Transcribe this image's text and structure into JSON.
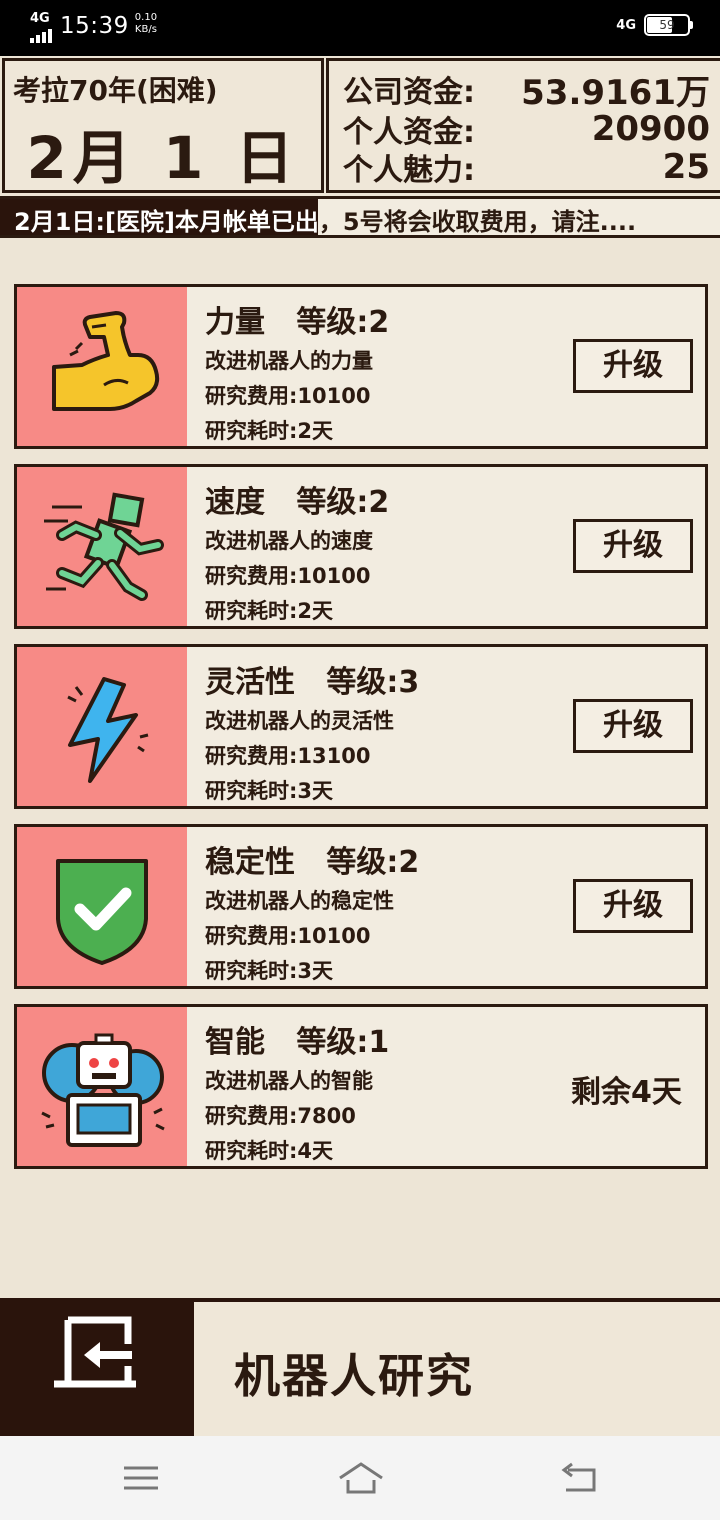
{
  "status_bar": {
    "network_left": "4G",
    "time": "15:39",
    "speed_value": "0.10",
    "speed_unit": "KB/s",
    "network_right": "4G",
    "battery": "59"
  },
  "header": {
    "game_title": "考拉70年(困难)",
    "date": "2月 1 日",
    "funds": [
      {
        "label": "公司资金:",
        "value": "53.9161万"
      },
      {
        "label": "个人资金:",
        "value": "20900"
      },
      {
        "label": "个人魅力:",
        "value": "25"
      }
    ]
  },
  "ticker": {
    "message": "2月1日:[医院]本月帐单已出，5号将会收取费用，请注...."
  },
  "research": {
    "items": [
      {
        "title": "力量   等级:2",
        "description": "改进机器人的力量",
        "cost": "研究费用:10100",
        "duration": "研究耗时:2天",
        "action": "升级",
        "icon": "flexed-arm-icon"
      },
      {
        "title": "速度   等级:2",
        "description": "改进机器人的速度",
        "cost": "研究费用:10100",
        "duration": "研究耗时:2天",
        "action": "升级",
        "icon": "running-robot-icon"
      },
      {
        "title": "灵活性   等级:3",
        "description": "改进机器人的灵活性",
        "cost": "研究费用:13100",
        "duration": "研究耗时:3天",
        "action": "升级",
        "icon": "lightning-icon"
      },
      {
        "title": "稳定性   等级:2",
        "description": "改进机器人的稳定性",
        "cost": "研究费用:10100",
        "duration": "研究耗时:3天",
        "action": "升级",
        "icon": "shield-check-icon"
      },
      {
        "title": "智能   等级:1",
        "description": "改进机器人的智能",
        "cost": "研究费用:7800",
        "duration": "研究耗时:4天",
        "status": "剩余4天",
        "icon": "robot-gear-icon"
      }
    ]
  },
  "footer": {
    "title": "机器人研究",
    "exit_icon": "exit-door-icon"
  },
  "nav": {
    "menu_icon": "menu-icon",
    "home_icon": "home-icon",
    "back_icon": "back-icon"
  },
  "colors": {
    "background": "#ede5d6",
    "dark": "#2a140c",
    "icon_bg": "#f78a86"
  }
}
